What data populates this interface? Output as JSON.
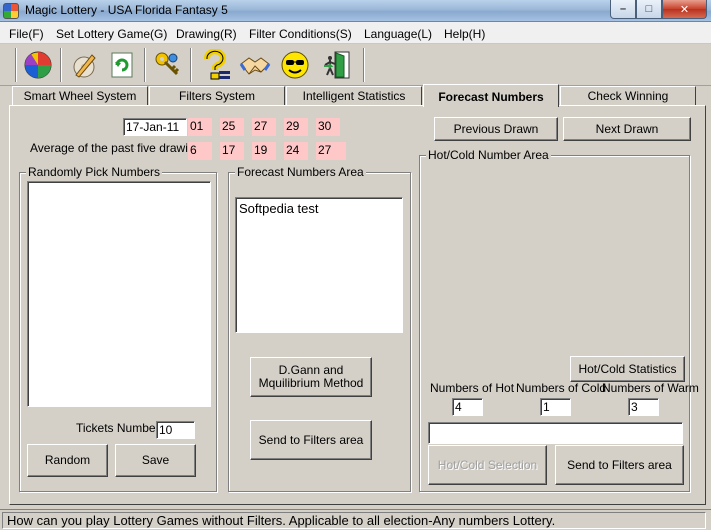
{
  "window": {
    "title": "Magic Lottery - USA Florida Fantasy 5",
    "min_glyph": "–",
    "max_glyph": "□",
    "close_glyph": "✕"
  },
  "menu": [
    "File(F)",
    "Set Lottery Game(G)",
    "Drawing(R)",
    "Filter Conditions(S)",
    "Language(L)",
    "Help(H)"
  ],
  "toolbar": {
    "icons": [
      "color-wheel-icon",
      "pencil-disc-icon",
      "refresh-icon",
      "keys-icon",
      "help-question-icon",
      "handshake-icon",
      "smiley-icon",
      "exit-door-icon"
    ]
  },
  "tabs": [
    "Smart Wheel System",
    "Filters System",
    "Intelligent Statistics",
    "Forecast Numbers",
    "Check Winning"
  ],
  "active_tab": "Forecast Numbers",
  "drawing": {
    "date": "17-Jan-11",
    "numbers": [
      "01",
      "25",
      "27",
      "29",
      "30"
    ],
    "average_label": "Average of the past five drawings",
    "averages": [
      "6",
      "17",
      "19",
      "24",
      "27"
    ]
  },
  "random_group": {
    "title": "Randomly Pick Numbers",
    "tickets_label": "Tickets Numbers",
    "tickets_value": "10",
    "random_button": "Random",
    "save_button": "Save"
  },
  "forecast_group": {
    "title": "Forecast Numbers Area",
    "text": "Softpedia test",
    "gann_button": "D.Gann and Mquilibrium Method",
    "send_button": "Send to Filters area"
  },
  "nav": {
    "previous_button": "Previous Drawn",
    "next_button": "Next Drawn"
  },
  "hotcold_group": {
    "title": "Hot/Cold Number Area",
    "stats_button": "Hot/Cold Statistics",
    "hot_label": "Numbers of Hot",
    "hot_value": "4",
    "cold_label": "Numbers of Cold",
    "cold_value": "1",
    "warm_label": "Numbers of Warm",
    "warm_value": "3",
    "selection_field": "",
    "selection_button": "Hot/Cold Selection",
    "send_button": "Send to Filters area"
  },
  "status": "How can you play Lottery Games without Filters. Applicable to all election-Any numbers Lottery."
}
